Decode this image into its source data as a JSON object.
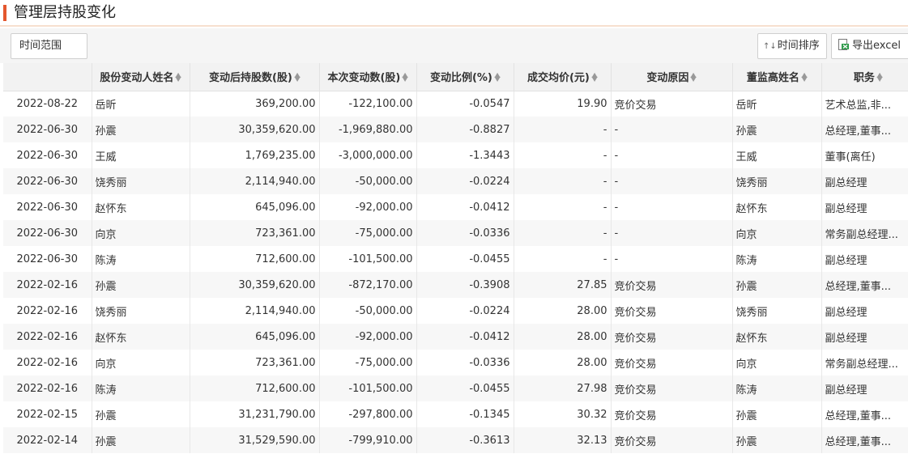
{
  "title": "管理层持股变化",
  "toolbar": {
    "range_label": "时间范围",
    "sort_label": "时间排序",
    "sort_icon": "↑↓",
    "export_label": "导出excel"
  },
  "columns": [
    "",
    "股份变动人姓名",
    "变动后持股数(股)",
    "本次变动数(股)",
    "变动比例(%)",
    "成交均价(元)",
    "变动原因",
    "董监高姓名",
    "职务"
  ],
  "rows": [
    {
      "date": "2022-08-22",
      "person": "岳昕",
      "after": "369,200.00",
      "change": "-122,100.00",
      "ratio": "-0.0547",
      "price": "19.90",
      "reason": "竞价交易",
      "exec": "岳昕",
      "title": "艺术总监,非..."
    },
    {
      "date": "2022-06-30",
      "person": "孙震",
      "after": "30,359,620.00",
      "change": "-1,969,880.00",
      "ratio": "-0.8827",
      "price": "-",
      "reason": "-",
      "exec": "孙震",
      "title": "总经理,董事..."
    },
    {
      "date": "2022-06-30",
      "person": "王威",
      "after": "1,769,235.00",
      "change": "-3,000,000.00",
      "ratio": "-1.3443",
      "price": "-",
      "reason": "-",
      "exec": "王威",
      "title": "董事(离任)"
    },
    {
      "date": "2022-06-30",
      "person": "饶秀丽",
      "after": "2,114,940.00",
      "change": "-50,000.00",
      "ratio": "-0.0224",
      "price": "-",
      "reason": "-",
      "exec": "饶秀丽",
      "title": "副总经理"
    },
    {
      "date": "2022-06-30",
      "person": "赵怀东",
      "after": "645,096.00",
      "change": "-92,000.00",
      "ratio": "-0.0412",
      "price": "-",
      "reason": "-",
      "exec": "赵怀东",
      "title": "副总经理"
    },
    {
      "date": "2022-06-30",
      "person": "向京",
      "after": "723,361.00",
      "change": "-75,000.00",
      "ratio": "-0.0336",
      "price": "-",
      "reason": "-",
      "exec": "向京",
      "title": "常务副总经理..."
    },
    {
      "date": "2022-06-30",
      "person": "陈涛",
      "after": "712,600.00",
      "change": "-101,500.00",
      "ratio": "-0.0455",
      "price": "-",
      "reason": "-",
      "exec": "陈涛",
      "title": "副总经理"
    },
    {
      "date": "2022-02-16",
      "person": "孙震",
      "after": "30,359,620.00",
      "change": "-872,170.00",
      "ratio": "-0.3908",
      "price": "27.85",
      "reason": "竞价交易",
      "exec": "孙震",
      "title": "总经理,董事..."
    },
    {
      "date": "2022-02-16",
      "person": "饶秀丽",
      "after": "2,114,940.00",
      "change": "-50,000.00",
      "ratio": "-0.0224",
      "price": "28.00",
      "reason": "竞价交易",
      "exec": "饶秀丽",
      "title": "副总经理"
    },
    {
      "date": "2022-02-16",
      "person": "赵怀东",
      "after": "645,096.00",
      "change": "-92,000.00",
      "ratio": "-0.0412",
      "price": "28.00",
      "reason": "竞价交易",
      "exec": "赵怀东",
      "title": "副总经理"
    },
    {
      "date": "2022-02-16",
      "person": "向京",
      "after": "723,361.00",
      "change": "-75,000.00",
      "ratio": "-0.0336",
      "price": "28.00",
      "reason": "竞价交易",
      "exec": "向京",
      "title": "常务副总经理..."
    },
    {
      "date": "2022-02-16",
      "person": "陈涛",
      "after": "712,600.00",
      "change": "-101,500.00",
      "ratio": "-0.0455",
      "price": "27.98",
      "reason": "竞价交易",
      "exec": "陈涛",
      "title": "副总经理"
    },
    {
      "date": "2022-02-15",
      "person": "孙震",
      "after": "31,231,790.00",
      "change": "-297,800.00",
      "ratio": "-0.1345",
      "price": "30.32",
      "reason": "竞价交易",
      "exec": "孙震",
      "title": "总经理,董事..."
    },
    {
      "date": "2022-02-14",
      "person": "孙震",
      "after": "31,529,590.00",
      "change": "-799,910.00",
      "ratio": "-0.3613",
      "price": "32.13",
      "reason": "竞价交易",
      "exec": "孙震",
      "title": "总经理,董事..."
    }
  ],
  "colors": {
    "accent": "#e4572e",
    "header_bg": "#f2f2f2",
    "alt_row_bg": "#f7f7f7",
    "toolbar_bg": "#f5f5f5"
  },
  "icons": {
    "sort_arrows": "sort-arrows-icon",
    "excel": "excel-icon"
  }
}
